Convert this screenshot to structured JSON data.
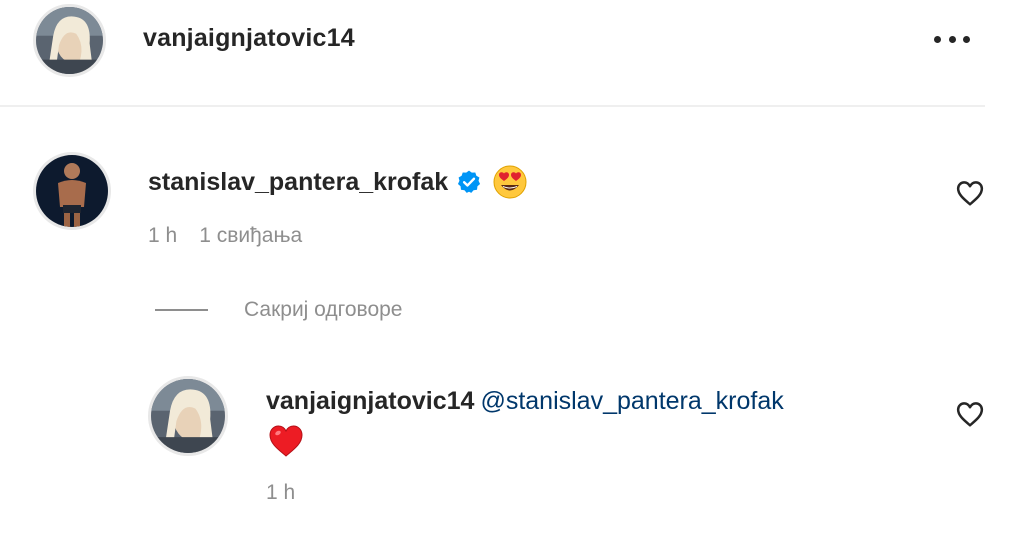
{
  "header": {
    "username": "vanjaignjatovic14",
    "more_icon": "more-horizontal-icon"
  },
  "comment": {
    "username": "stanislav_pantera_krofak",
    "verified_icon": "verified-badge-icon",
    "emoji": "heart-eyes-emoji",
    "time": "1 h",
    "likes": "1 свиђања",
    "like_icon": "heart-outline-icon"
  },
  "replies_toggle": {
    "label": "Сакриј одговоре"
  },
  "reply": {
    "username": "vanjaignjatovic14",
    "mention": "@stanislav_pantera_krofak",
    "emoji": "red-heart-emoji",
    "time": "1 h",
    "like_icon": "heart-outline-icon"
  },
  "colors": {
    "text": "#262626",
    "secondary": "#8e8e8e",
    "mention": "#00376b",
    "verified": "#0095f6",
    "heart": "#ed1c24"
  }
}
